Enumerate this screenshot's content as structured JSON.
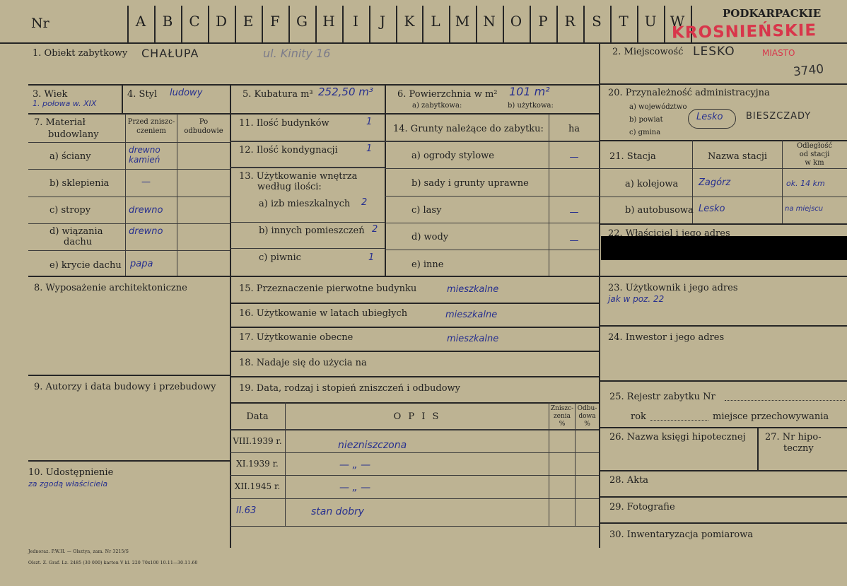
{
  "header": {
    "nr_label": "Nr",
    "letters": [
      "A",
      "B",
      "C",
      "D",
      "E",
      "F",
      "G",
      "H",
      "I",
      "J",
      "K",
      "L",
      "M",
      "N",
      "O",
      "P",
      "R",
      "S",
      "T",
      "U",
      "W"
    ],
    "region_print": "PODKARPACKIE",
    "region_stamp": "KROSNIEŃSKIE",
    "archive_number": "3740"
  },
  "fields": {
    "f1_label": "1. Obiekt zabytkowy",
    "f1_value": "CHAŁUPA",
    "f1_address": "ul. Kinity 16",
    "f2_label": "2. Miejscowość",
    "f2_value": "LESKO",
    "f2_note": "MIASTO",
    "f3_label": "3. Wiek",
    "f3_value": "1. połowa w. XIX",
    "f4_label": "4. Styl",
    "f4_value": "ludowy",
    "f5_label": "5. Kubatura m³",
    "f5_value": "252,50 m³",
    "f6_label": "6. Powierzchnia w m²",
    "f6_value": "101 m²",
    "f6_sub_a": "a) zabytkowa:",
    "f6_sub_b": "b) użytkowa:",
    "f7_label_line1": "7. Materiał",
    "f7_label_line2": "budowlany",
    "f7_col_before_1": "Przed zniszc-",
    "f7_col_before_2": "czeniem",
    "f7_col_after_1": "Po",
    "f7_col_after_2": "odbudowie",
    "f7_rows": [
      {
        "label": "a) ściany",
        "label2": "",
        "value": "drewno",
        "value2": "kamień"
      },
      {
        "label": "b) sklepienia",
        "label2": "",
        "value": "—",
        "value2": ""
      },
      {
        "label": "c) stropy",
        "label2": "",
        "value": "drewno",
        "value2": ""
      },
      {
        "label": "d) wiązania",
        "label2": "dachu",
        "value": "drewno",
        "value2": ""
      },
      {
        "label": "e) krycie dachu",
        "label2": "",
        "value": "papa",
        "value2": ""
      }
    ],
    "f8_label": "8. Wyposażenie architektoniczne",
    "f9_label": "9. Autorzy i data budowy i przebudowy",
    "f10_label": "10. Udostępnienie",
    "f10_value": "za zgodą właściciela",
    "f11_label": "11. Ilość budynków",
    "f11_value": "1",
    "f12_label": "12. Ilość kondygnacji",
    "f12_value": "1",
    "f13_label_line1": "13. Użytkowanie wnętrza",
    "f13_label_line2": "według ilości:",
    "f13_rows": [
      {
        "label": "a) izb mieszkalnych",
        "value": "2"
      },
      {
        "label": "b) innych pomieszczeń",
        "value": "2"
      },
      {
        "label": "c) piwnic",
        "value": "1"
      }
    ],
    "f14_label": "14. Grunty należące do zabytku:",
    "f14_unit": "ha",
    "f14_rows": [
      {
        "label": "a) ogrody stylowe",
        "value": "—"
      },
      {
        "label": "b) sady i grunty uprawne",
        "value": ""
      },
      {
        "label": "c) lasy",
        "value": "—"
      },
      {
        "label": "d) wody",
        "value": "—"
      },
      {
        "label": "e) inne",
        "value": ""
      }
    ],
    "f15_label": "15. Przeznaczenie pierwotne budynku",
    "f15_value": "mieszkalne",
    "f16_label": "16. Użytkowanie w latach ubiegłych",
    "f16_value": "mieszkalne",
    "f17_label": "17. Użytkowanie obecne",
    "f17_value": "mieszkalne",
    "f18_label": "18. Nadaje się do użycia na",
    "f19_label": "19. Data, rodzaj i stopień zniszczeń i odbudowy",
    "f19_col_date": "Data",
    "f19_col_opis": "O P I S",
    "f19_col_destr_1": "Zniszc-",
    "f19_col_destr_2": "zenia",
    "f19_col_destr_3": "%",
    "f19_col_rebuild_1": "Odbu-",
    "f19_col_rebuild_2": "dowa",
    "f19_col_rebuild_3": "%",
    "f19_rows": [
      {
        "date": "VIII.1939 r.",
        "opis": "niezniszczona"
      },
      {
        "date": "XI.1939 r.",
        "opis": "— „ —"
      },
      {
        "date": "XII.1945 r.",
        "opis": "— „ —"
      },
      {
        "date": "II.63",
        "opis": "stan dobry"
      }
    ],
    "f20_label": "20. Przynależność administracyjna",
    "f20_sub_a": "a) województwo",
    "f20_sub_b": "b) powiat",
    "f20_sub_c": "c) gmina",
    "f20_b_value": "Lesko",
    "f20_b_value2": "BIESZCZADY",
    "f21_label": "21. Stacja",
    "f21_col_name": "Nazwa stacji",
    "f21_col_dist_1": "Odległość",
    "f21_col_dist_2": "od stacji",
    "f21_col_dist_3": "w km",
    "f21_rows": [
      {
        "label": "a) kolejowa",
        "name": "Zagórz",
        "dist": "ok. 14 km"
      },
      {
        "label": "b) autobusowa",
        "name": "Lesko",
        "dist": "na miejscu"
      }
    ],
    "f22_label": "22. Właściciel i jego adres",
    "f23_label": "23. Użytkownik i jego adres",
    "f23_value": "jak w poz. 22",
    "f24_label": "24. Inwestor i jego adres",
    "f25_label": "25. Rejestr zabytku Nr",
    "f25_sub_rok": "rok",
    "f25_sub_miejsce": "miejsce przechowywania",
    "f26_label": "26. Nazwa księgi hipotecznej",
    "f27_label_1": "27. Nr hipo-",
    "f27_label_2": "teczny",
    "f28_label": "28. Akta",
    "f29_label": "29. Fotografie",
    "f30_label": "30. Inwentaryzacja pomiarowa"
  },
  "footer": {
    "line1": "Jednoraz. P.W.H. — Olsztyn, zam. Nr 3215/S",
    "line2": "Olszt. Z. Graf. Lz. 2485 (30 000) karton V kl. 220 70x100 10.11—30.11.60"
  }
}
